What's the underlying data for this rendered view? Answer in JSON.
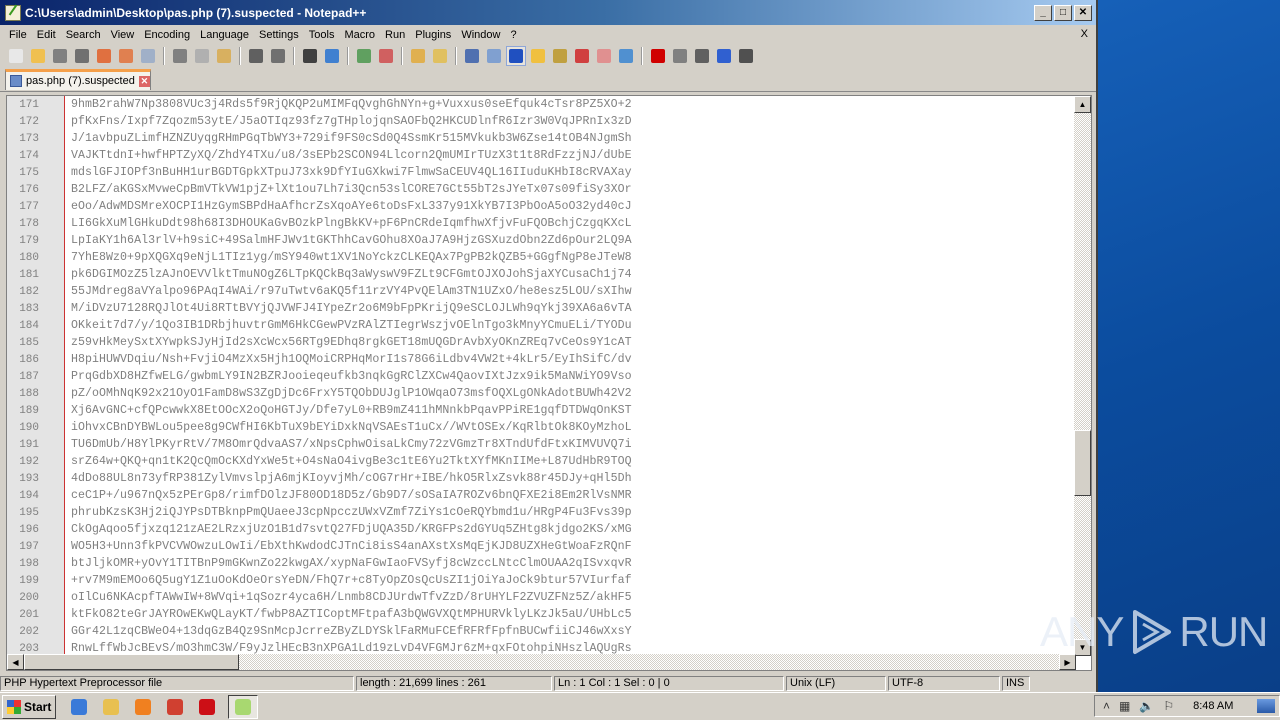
{
  "window": {
    "title": "C:\\Users\\admin\\Desktop\\pas.php (7).suspected - Notepad++",
    "buttons": {
      "minimize": "_",
      "maximize": "□",
      "close": "✕"
    }
  },
  "menubar": {
    "items": [
      "File",
      "Edit",
      "Search",
      "View",
      "Encoding",
      "Language",
      "Settings",
      "Tools",
      "Macro",
      "Run",
      "Plugins",
      "Window",
      "?"
    ],
    "close_doc": "X"
  },
  "toolbar": {
    "groups": [
      [
        {
          "name": "new-file-icon",
          "color": "#e8e8e8"
        },
        {
          "name": "open-file-icon",
          "color": "#f0c050"
        },
        {
          "name": "save-icon",
          "color": "#808080"
        },
        {
          "name": "save-all-icon",
          "color": "#707070"
        },
        {
          "name": "close-icon",
          "color": "#e07040"
        },
        {
          "name": "close-all-icon",
          "color": "#e08050"
        },
        {
          "name": "print-icon",
          "color": "#a0b0c8"
        }
      ],
      [
        {
          "name": "cut-icon",
          "color": "#808080"
        },
        {
          "name": "copy-icon",
          "color": "#b0b0b0"
        },
        {
          "name": "paste-icon",
          "color": "#d8b060"
        }
      ],
      [
        {
          "name": "undo-icon",
          "color": "#606060"
        },
        {
          "name": "redo-icon",
          "color": "#707070"
        }
      ],
      [
        {
          "name": "find-icon",
          "color": "#404040"
        },
        {
          "name": "replace-icon",
          "color": "#4080d0"
        }
      ],
      [
        {
          "name": "zoom-in-icon",
          "color": "#60a060"
        },
        {
          "name": "zoom-out-icon",
          "color": "#d06060"
        }
      ],
      [
        {
          "name": "sync-vertical-icon",
          "color": "#e0b050"
        },
        {
          "name": "sync-horizontal-icon",
          "color": "#e0c060"
        }
      ],
      [
        {
          "name": "word-wrap-icon",
          "color": "#5070b0"
        },
        {
          "name": "show-all-chars-icon",
          "color": "#80a0d0"
        },
        {
          "name": "indent-guide-icon",
          "color": "#2050c0",
          "selected": true
        },
        {
          "name": "user-defined-language-icon",
          "color": "#f0c040"
        },
        {
          "name": "document-map-icon",
          "color": "#c0a040"
        },
        {
          "name": "function-list-icon",
          "color": "#d04040"
        },
        {
          "name": "folder-as-workspace-icon",
          "color": "#e09090"
        },
        {
          "name": "monitoring-icon",
          "color": "#5090d0"
        }
      ],
      [
        {
          "name": "record-macro-icon",
          "color": "#d00000"
        },
        {
          "name": "stop-recording-icon",
          "color": "#808080"
        },
        {
          "name": "playback-icon",
          "color": "#606060"
        },
        {
          "name": "run-macro-multiple-icon",
          "color": "#3060d0"
        },
        {
          "name": "save-macro-icon",
          "color": "#505050"
        }
      ]
    ]
  },
  "tab": {
    "label": "pas.php (7).suspected",
    "close": "✕"
  },
  "editor": {
    "lines": [
      {
        "n": "171",
        "text": "9hmB2rahW7Np3808VUc3j4Rds5f9RjQKQP2uMIMFqQvghGhNYn+g+Vuxxus0seEfquk4cTsr8PZ5XO+2"
      },
      {
        "n": "172",
        "text": "pfKxFns/Ixpf7Zqozm53ytE/J5aOTIqz93fz7gTHplojqnSAOFbQ2HKCUDlnfR6Izr3W0VqJPRnIx3zD"
      },
      {
        "n": "173",
        "text": "J/1avbpuZLimfHZNZUyqgRHmPGqTbWY3+729if9FS0cSd0Q4SsmKr515MVkukb3W6Zse14tOB4NJgmSh"
      },
      {
        "n": "174",
        "text": "VAJKTtdnI+hwfHPTZyXQ/ZhdY4TXu/u8/3sEPb2SCON94Llcorn2QmUMIrTUzX3t1t8RdFzzjNJ/dUbE"
      },
      {
        "n": "175",
        "text": "mdslGFJIOPf3nBuHH1urBGDTGpkXTpuJ73xk9DfYIuGXkwi7FlmwSaCEUV4QL16IIuduKHbI8cRVAXay"
      },
      {
        "n": "176",
        "text": "B2LFZ/aKGSxMvweCpBmVTkVW1pjZ+lXt1ou7Lh7i3Qcn53slCORE7GCt55bT2sJYeTx07s09fiSy3XOr"
      },
      {
        "n": "177",
        "text": "eOo/AdwMDSMreXOCPI1HzGymSBPdHaAfhcrZsXqoAYe6toDsFxL337y91XkYB7I3PbOoA5oO32yd40cJ"
      },
      {
        "n": "178",
        "text": "LI6GkXuMlGHkuDdt98h68I3DHOUKaGvBOzkPlngBkKV+pF6PnCRdeIqmfhwXfjvFuFQOBchjCzgqKXcL"
      },
      {
        "n": "179",
        "text": "LpIaKY1h6Al3rlV+h9siC+49SalmHFJWv1tGKThhCavGOhu8XOaJ7A9HjzGSXuzdObn2Zd6pOur2LQ9A"
      },
      {
        "n": "180",
        "text": "7YhE8Wz0+9pXQGXq9eNjL1TIz1yg/mSY940wt1XV1NoYckzCLKEQAx7PgPB2kQZB5+GGgfNgP8eJTeW8"
      },
      {
        "n": "181",
        "text": "pk6DGIMOzZ5lzAJnOEVVlktTmuNOgZ6LTpKQCkBq3aWyswV9FZLt9CFGmtOJXOJohSjaXYCusaCh1j74"
      },
      {
        "n": "182",
        "text": "55JMdreg8aVYalpo96PAqI4WAi/r97uTwtv6aKQ5f11rzVY4PvQElAm3TN1UZxO/he8esz5LOU/sXIhw"
      },
      {
        "n": "183",
        "text": "M/iDVzU7128RQJlOt4Ui8RTtBVYjQJVWFJ4IYpeZr2o6M9bFpPKrijQ9eSCLOJLWh9qYkj39XA6a6vTA"
      },
      {
        "n": "184",
        "text": "OKkeit7d7/y/1Qo3IB1DRbjhuvtrGmM6HkCGewPVzRAlZTIegrWszjvOElnTgo3kMnyYCmuELi/TYODu"
      },
      {
        "n": "185",
        "text": "z59vHkMeySxtXYwpkSJyHjId2sXcWcx56RTg9EDhq8rgkGET18mUQGDrAvbXyOKnZREq7vCeOs9Y1cAT"
      },
      {
        "n": "186",
        "text": "H8piHUWVDqiu/Nsh+FvjiO4MzXx5Hjh1OQMoiCRPHqMorI1s78G6iLdbv4VW2t+4kLr5/EyIhSifC/dv"
      },
      {
        "n": "187",
        "text": "PrqGdbXD8HZfwELG/gwbmLY9IN2BZRJooieqeufkb3nqkGgRClZXCw4QaovIXtJzx9ik5MaNWiYO9Vso"
      },
      {
        "n": "188",
        "text": "pZ/oOMhNqK92x21OyO1FamD8wS3ZgDjDc6FrxY5TQObDUJglP1OWqaO73msfOQXLgONkAdotBUWh42V2"
      },
      {
        "n": "189",
        "text": "Xj6AvGNC+cfQPcwwkX8EtOOcX2oQoHGTJy/Dfe7yL0+RB9mZ411hMNnkbPqavPPiRE1gqfDTDWqOnKST"
      },
      {
        "n": "190",
        "text": "iOhvxCBnDYBWLou5pee8g9CWfHI6KbTuX9bEYiDxkNqVSAEsT1uCx//WVtOSEx/KqRlbtOk8KOyMzhoL"
      },
      {
        "n": "191",
        "text": "TU6DmUb/H8YlPKyrRtV/7M8OmrQdvaAS7/xNpsCphwOisaLkCmy72zVGmzTr8XTndUfdFtxKIMVUVQ7i"
      },
      {
        "n": "192",
        "text": "srZ64w+QKQ+qn1tK2QcQmOcKXdYxWe5t+O4sNaO4ivgBe3c1tE6Yu2TktXYfMKnIIMe+L87UdHbR9TOQ"
      },
      {
        "n": "193",
        "text": "4dDo88UL8n73yfRP381ZylVmvslpjA6mjKIoyvjMh/cOG7rHr+IBE/hkO5RlxZsvk88r45DJy+qHl5Dh"
      },
      {
        "n": "194",
        "text": "ceC1P+/u967nQx5zPErGp8/rimfDOlzJF80OD18D5z/Gb9D7/sOSaIA7ROZv6bnQFXE2i8Em2RlVsNMR"
      },
      {
        "n": "195",
        "text": "phrubKzsK3Hj2iQJYPsDTBknpPmQUaeeJ3cpNpcczUWxVZmf7ZiYs1cOeRQYbmd1u/HRgP4Fu3Fvs39p"
      },
      {
        "n": "196",
        "text": "CkOgAqoo5fjxzq121zAE2LRzxjUzO1B1d7svtQ27FDjUQA35D/KRGFPs2dGYUq5ZHtg8kjdgo2KS/xMG"
      },
      {
        "n": "197",
        "text": "WO5H3+Unn3fkPVCVWOwzuLOwIi/EbXthKwdodCJTnCi8isS4anAXstXsMqEjKJD8UZXHeGtWoaFzRQnF"
      },
      {
        "n": "198",
        "text": "btJljkOMR+yOvY1TITBnP9mGKwnZo22kwgAX/xypNaFGwIaoFVSyfj8cWzccLNtcClmOUAA2qISvxqvR"
      },
      {
        "n": "199",
        "text": "+rv7M9mEMOo6Q5ugY1Z1uOoKdOeOrsYeDN/FhQ7r+c8TyOpZOsQcUsZI1jOiYaJoCk9btur57VIurfaf"
      },
      {
        "n": "200",
        "text": "oIlCu6NKAcpfTAWwIW+8WVqi+1qSozr4yca6H/Lnmb8CDJUrdwTfvZzD/8rUHYLF2ZVUZFNz5Z/akHF5"
      },
      {
        "n": "201",
        "text": "ktFkO82teGrJAYROwEKwQLayKT/fwbP8AZTICoptMFtpafA3bQWGVXQtMPHURVklyLKzJk5aU/UHbLc5"
      },
      {
        "n": "202",
        "text": "GGr42L1zqCBWeO4+13dqGzB4Qz9SnMcpJcrreZByZLDYSklFaRMuFCEfRFRfFpfnBUCwfiiCJ46wXxsY"
      },
      {
        "n": "203",
        "text": "RnwLffWbJcBEvS/mO3hmC3W/F9yJzlHEcB3nXPGA1Ld19zLvD4VFGMJr6zM+qxFOtohpiNHszlAQUgRs"
      }
    ],
    "vscroll_position_fraction": 0.69
  },
  "statusbar": {
    "file_type": "PHP Hypertext Preprocessor file",
    "length_lines": "length : 21,699    lines : 261",
    "cursor": "Ln : 1    Col : 1    Sel : 0 | 0",
    "eol": "Unix (LF)",
    "encoding": "UTF-8",
    "mode": "INS"
  },
  "watermark": {
    "left": "ANY",
    "right": "RUN"
  },
  "taskbar": {
    "start_label": "Start",
    "apps": [
      {
        "name": "internet-explorer-icon",
        "color": "#3a7ad8"
      },
      {
        "name": "file-explorer-icon",
        "color": "#e8c050"
      },
      {
        "name": "media-player-icon",
        "color": "#f08020"
      },
      {
        "name": "chrome-icon",
        "color": "#d04030"
      },
      {
        "name": "opera-icon",
        "color": "#cc0f16"
      },
      {
        "name": "notepadpp-icon",
        "color": "#a8d870",
        "active": true
      }
    ],
    "tray": {
      "expand": "˄",
      "clock": "8:48 AM"
    }
  }
}
